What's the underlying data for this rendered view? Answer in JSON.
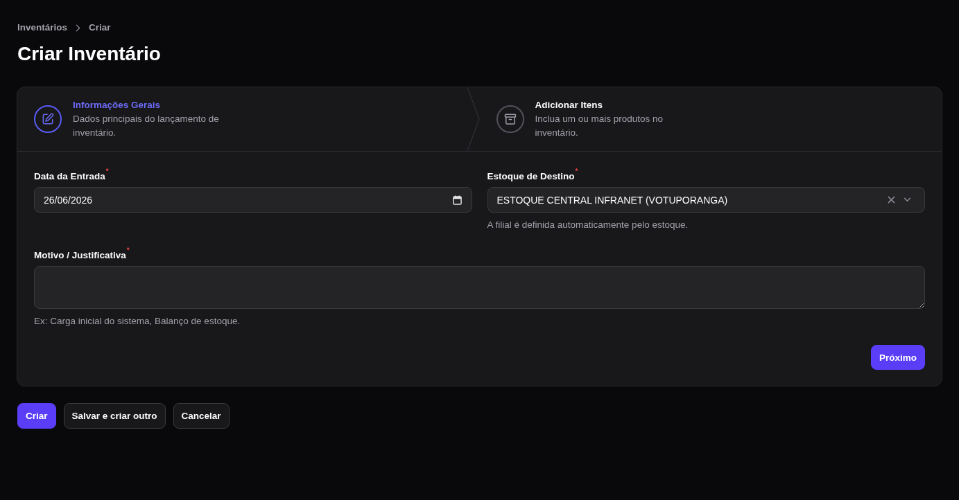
{
  "breadcrumbs": [
    {
      "label": "Inventários"
    },
    {
      "label": "Criar"
    }
  ],
  "page_title": "Criar Inventário",
  "wizard": {
    "steps": [
      {
        "title": "Informações Gerais",
        "description": "Dados principais do lançamento de inventário.",
        "selected": true
      },
      {
        "title": "Adicionar Itens",
        "description": "Inclua um ou mais produtos no inventário.",
        "selected": false
      }
    ],
    "next_button": "Próximo"
  },
  "form": {
    "fields": [
      {
        "kind": "date",
        "label": "Data da Entrada$^{*}$",
        "value": "26/06/2026"
      },
      {
        "kind": "select",
        "label": "Estoque de Destino$^{*}$",
        "value": "ESTOQUE CENTRAL INFRANET (VOTUPORANGA)",
        "hint": "A filial é definida automaticamente pelo estoque."
      },
      {
        "kind": "textarea",
        "label": "Motivo / Justificativa$^{*}$",
        "hint": "Ex: Carga inicial do sistema, Balanço de estoque."
      }
    ]
  },
  "actions": [
    {
      "label": "Criar",
      "kind": "primary"
    },
    {
      "label": "Salvar e criar outro",
      "kind": "secondary"
    },
    {
      "label": "Cancelar",
      "kind": "secondary"
    }
  ]
}
